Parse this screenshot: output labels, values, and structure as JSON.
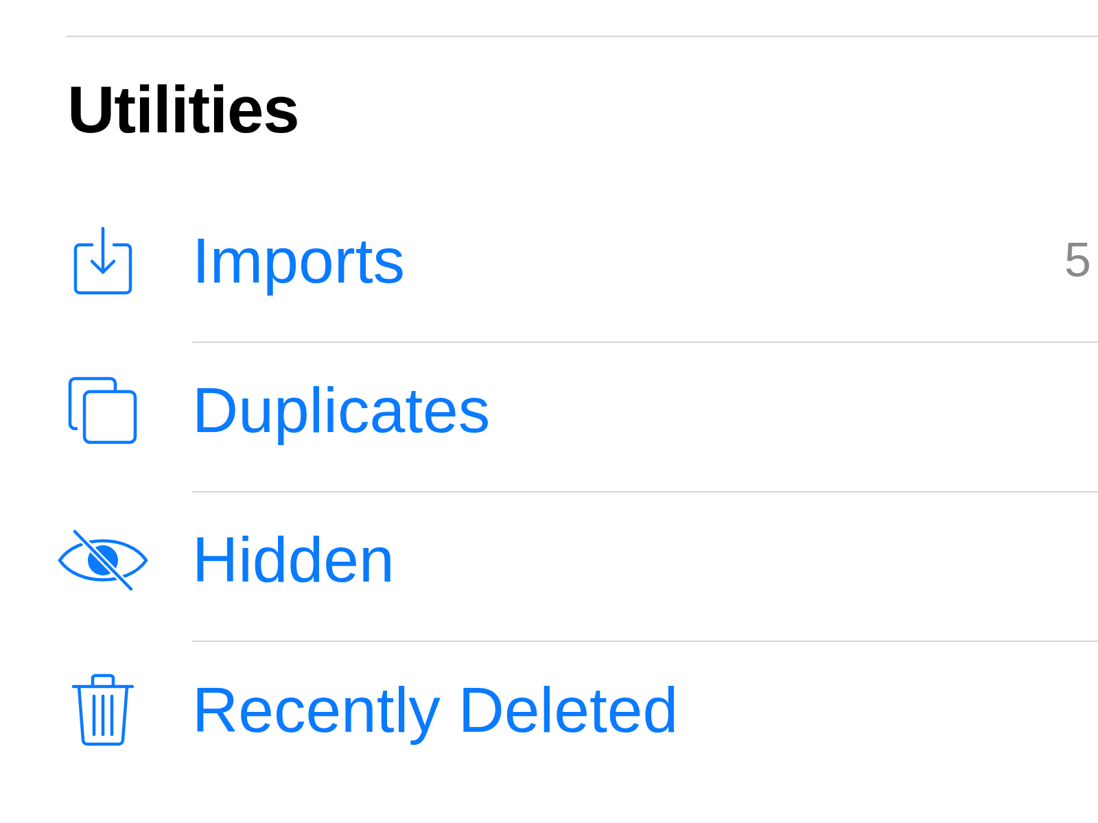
{
  "section": {
    "title": "Utilities",
    "items": [
      {
        "kind": "import",
        "label": "Imports",
        "count": "5"
      },
      {
        "kind": "duplicate",
        "label": "Duplicates"
      },
      {
        "kind": "hidden",
        "label": "Hidden"
      },
      {
        "kind": "trash",
        "label": "Recently Deleted"
      }
    ]
  }
}
